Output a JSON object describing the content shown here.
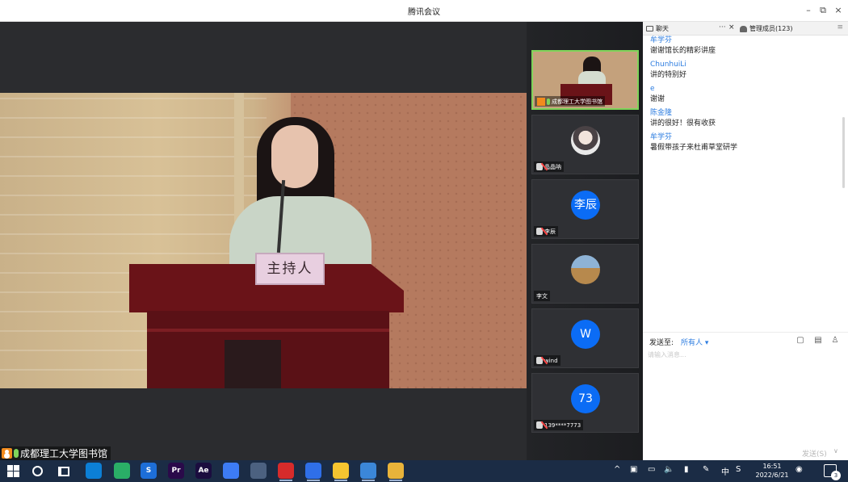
{
  "window": {
    "title": "腾讯会议",
    "controls": {
      "minimize": "–",
      "restore": "⧉",
      "close": "×"
    }
  },
  "main_video": {
    "speaker_name": "成都理工大学图书馆",
    "nameplate": "主持人"
  },
  "participants": [
    {
      "name": "成都理工大学图书馆",
      "avatar_type": "video",
      "active": true
    },
    {
      "name": "晶晶呐",
      "avatar_type": "photo"
    },
    {
      "name": "李辰",
      "avatar_type": "letter",
      "avatar_text": "李辰"
    },
    {
      "name": "李文",
      "avatar_type": "photo"
    },
    {
      "name": "wind",
      "avatar_type": "letter",
      "avatar_text": "W"
    },
    {
      "name": "139****7773",
      "avatar_type": "letter",
      "avatar_text": "73"
    }
  ],
  "panel": {
    "tabs": {
      "chat": "聊天",
      "more": "···",
      "close": "×",
      "members": "管理成员(123)",
      "menu": "≡"
    },
    "messages": [
      {
        "sender": "牟学芬",
        "text": "谢谢馆长的精彩讲座"
      },
      {
        "sender": "ChunhuiLi",
        "text": "讲的特别好"
      },
      {
        "sender": "e",
        "text": "谢谢"
      },
      {
        "sender": "陈金隆",
        "text": "讲的很好！很有收获"
      },
      {
        "sender": "牟学芬",
        "text": "暑假带孩子来杜甫草堂研学"
      }
    ],
    "compose": {
      "send_to_label": "发送至:",
      "send_to_target": "所有人",
      "placeholder": "请输入消息...",
      "send_button": "发送(S)"
    }
  },
  "taskbar": {
    "apps": [
      {
        "name": "edge-icon",
        "label": "",
        "color": "#0c7fd6"
      },
      {
        "name": "wechat-icon",
        "label": "",
        "color": "#2aae67"
      },
      {
        "name": "sogou-icon",
        "label": "S",
        "color": "#1d6ed8"
      },
      {
        "name": "premiere-icon",
        "label": "Pr",
        "color": "#2a0a4a"
      },
      {
        "name": "aftereffects-icon",
        "label": "Ae",
        "color": "#1b0d3f"
      },
      {
        "name": "feishu-icon",
        "label": "",
        "color": "#3d7cf5"
      },
      {
        "name": "cloud-icon",
        "label": "",
        "color": "#4c6180"
      },
      {
        "name": "netease-music-icon",
        "label": "",
        "color": "#d62b2b"
      },
      {
        "name": "tencent-meeting-icon",
        "label": "",
        "color": "#2f6fe8"
      },
      {
        "name": "chrome-icon",
        "label": "",
        "color": "#f4c430"
      },
      {
        "name": "image-viewer-icon",
        "label": "",
        "color": "#3b87d9"
      },
      {
        "name": "file-explorer-icon",
        "label": "",
        "color": "#e8b33a"
      }
    ],
    "tray": {
      "ime": "中",
      "volume": "🔈",
      "time": "16:51",
      "date": "2022/6/21",
      "notifications": "3"
    }
  },
  "colors": {
    "accent": "#2d7de0",
    "avatar_blue": "#0b6cf5",
    "active_border": "#7fd45a",
    "taskbar": "#1b2c45"
  }
}
